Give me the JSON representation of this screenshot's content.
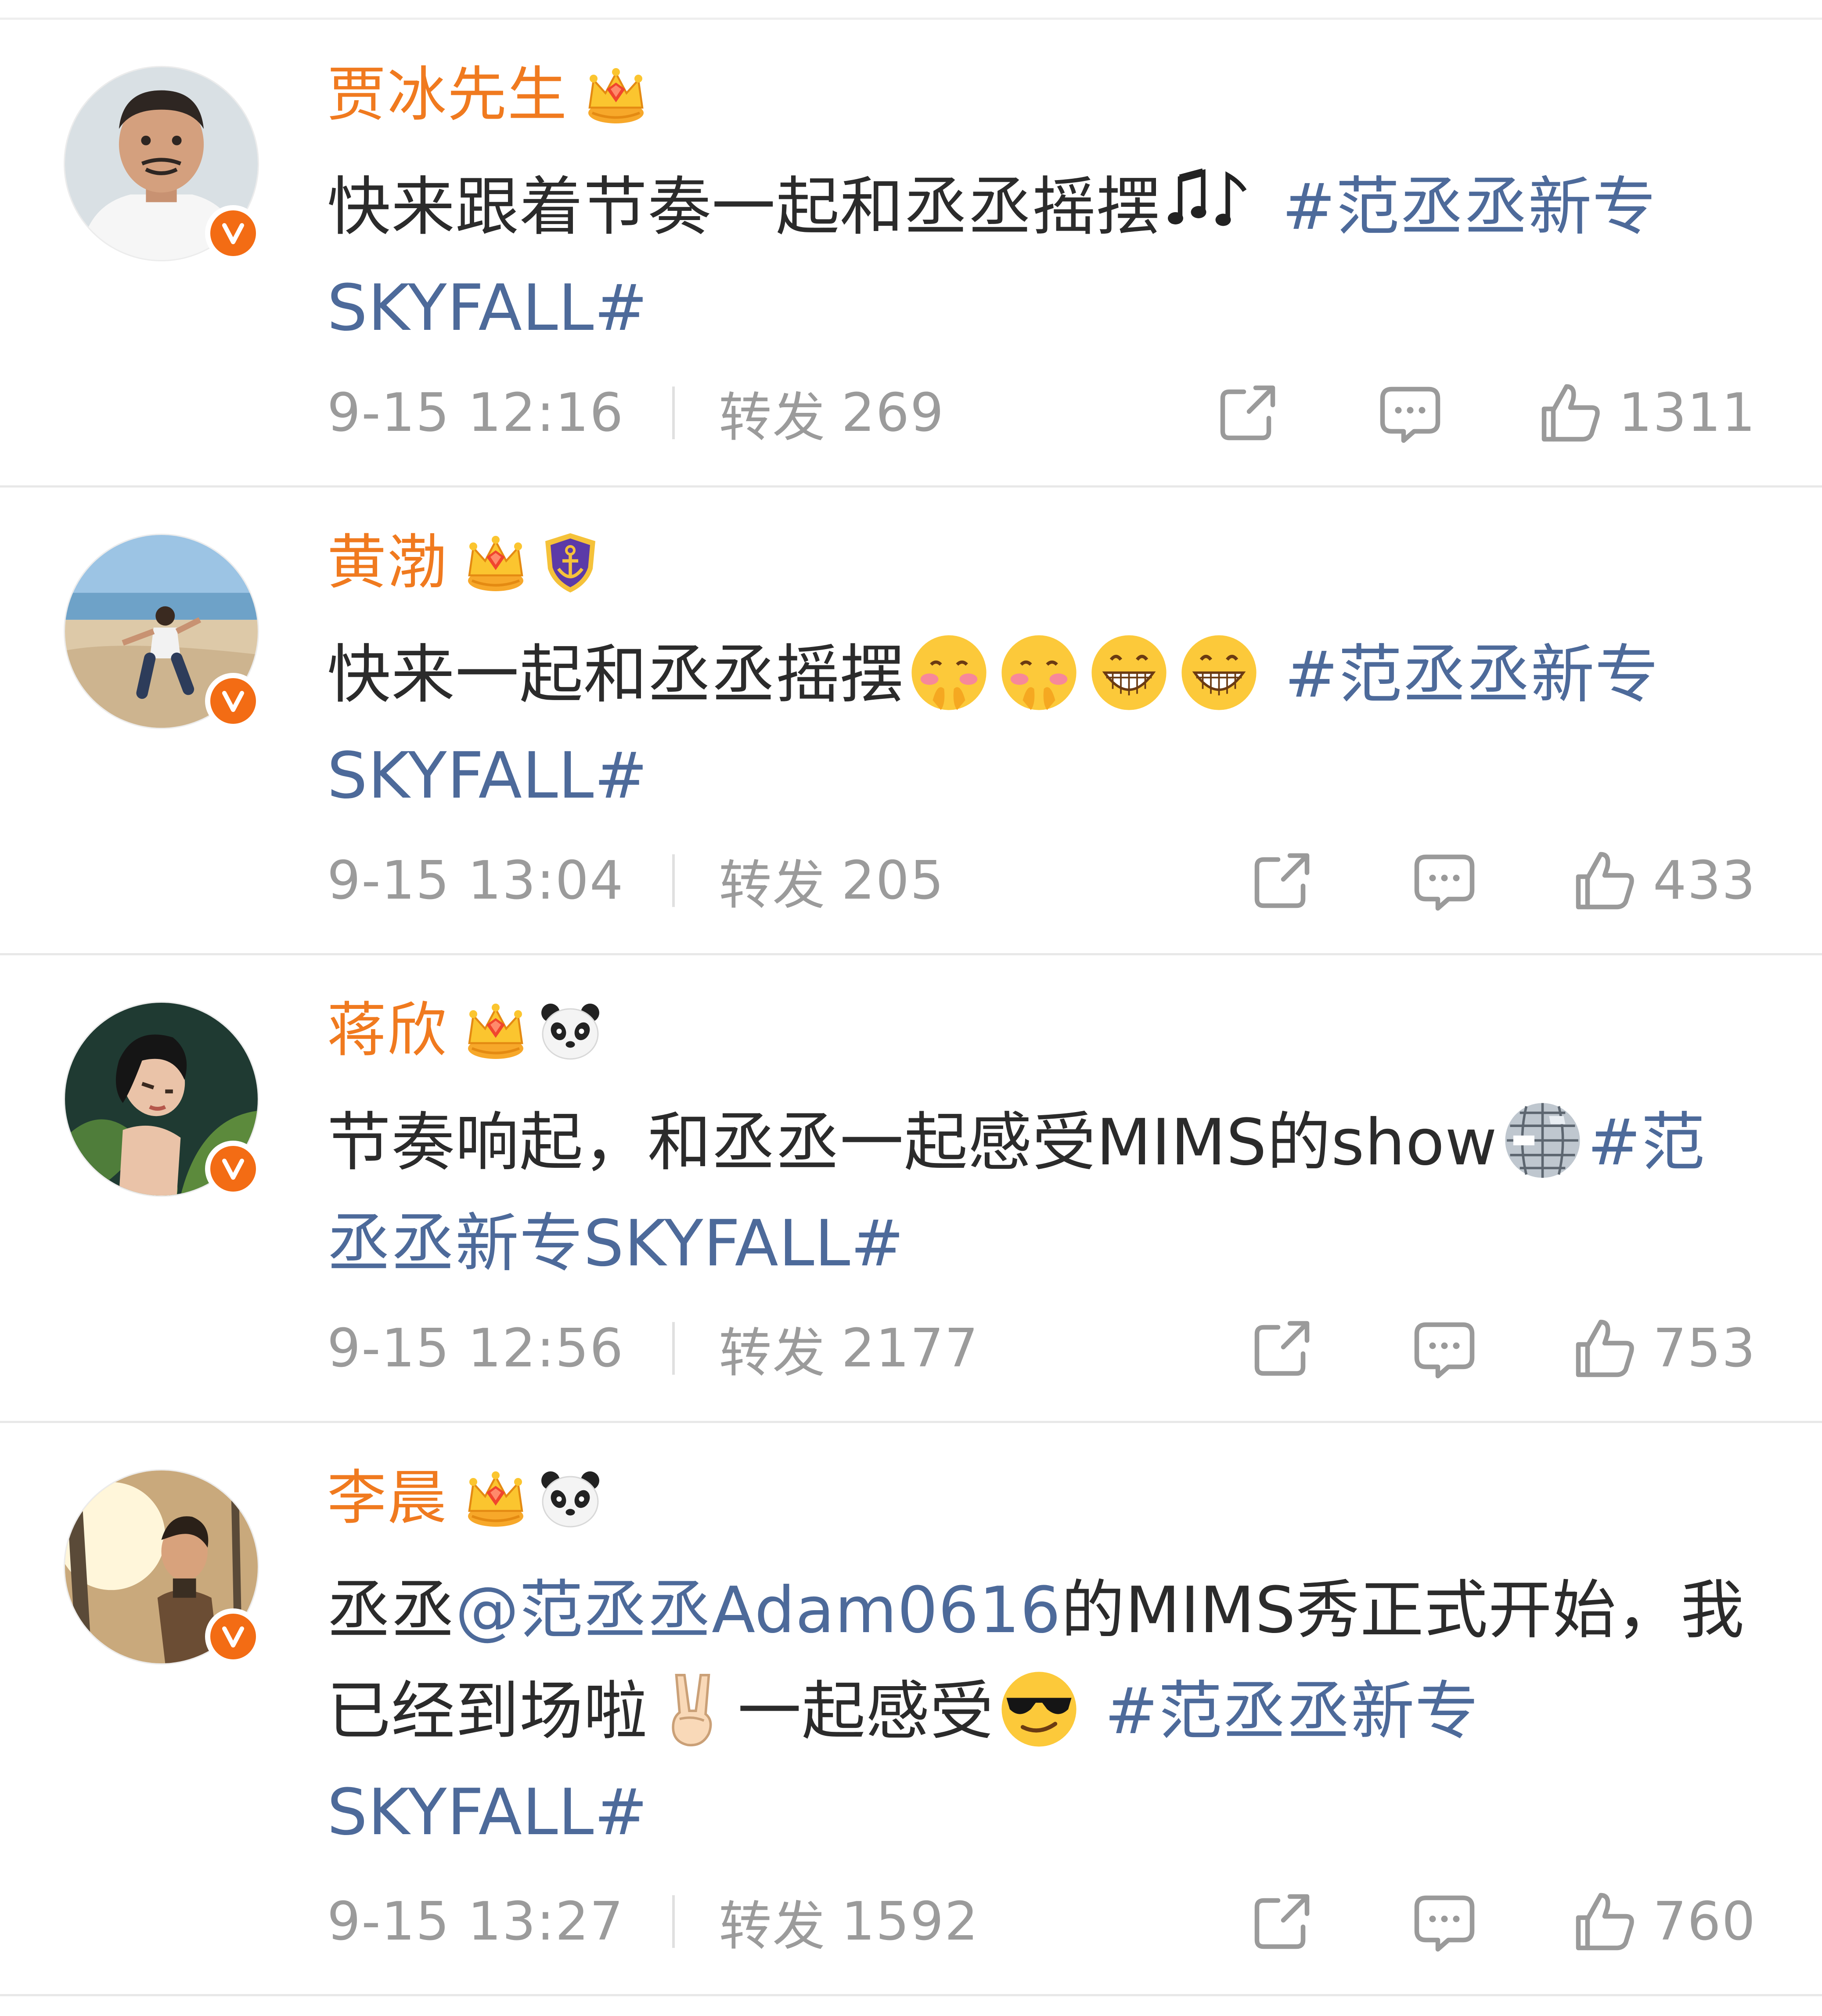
{
  "colors": {
    "username": "#f07a1f",
    "topic": "#4d6a9a",
    "body_text": "#2b2b2b",
    "meta_text": "#9b9b9b",
    "verified_badge": "#f36c14",
    "divider": "#e8e8e8"
  },
  "posts": [
    {
      "username": "贾冰先生",
      "badges": [
        "crown-icon"
      ],
      "avatar": "portrait-man-white-shirt",
      "content": {
        "text": "快来跟着节奏一起和丞丞摇摆",
        "emojis": [
          "music-notes-icon"
        ],
        "topic": "#范丞丞新专SKYFALL#"
      },
      "time": "9-15 12:16",
      "repost_label": "转发",
      "repost_count": "269",
      "like_count": "1311"
    },
    {
      "username": "黄渤",
      "badges": [
        "crown-icon",
        "anchor-shield-icon"
      ],
      "avatar": "man-on-beach",
      "content": {
        "text": "快来一起和丞丞摇摆",
        "emojis": [
          "shy-face-icon",
          "shy-face-icon",
          "grin-face-icon",
          "grin-face-icon"
        ],
        "topic": "#范丞丞新专SKYFALL#"
      },
      "time": "9-15 13:04",
      "repost_label": "转发",
      "repost_count": "205",
      "like_count": "433"
    },
    {
      "username": "蒋欣",
      "badges": [
        "crown-icon",
        "panda-icon"
      ],
      "avatar": "woman-with-plants",
      "content": {
        "text": "节奏响起，和丞丞一起感受MIMS的show",
        "emojis": [
          "disco-ball-icon"
        ],
        "topic": "#范丞丞新专SKYFALL#"
      },
      "time": "9-15 12:56",
      "repost_label": "转发",
      "repost_count": "2177",
      "like_count": "753"
    },
    {
      "username": "李晨",
      "badges": [
        "crown-icon",
        "panda-icon"
      ],
      "avatar": "man-in-sunlight",
      "content": {
        "text_before": "丞丞",
        "mention": "@范丞丞Adam0616",
        "text_middle": "的MIMS秀正式开始，我已经到场啦",
        "text_after": "一起感受",
        "emojis": [
          "victory-hand-icon",
          "sunglasses-face-icon"
        ],
        "topic": "#范丞丞新专SKYFALL#"
      },
      "time": "9-15 13:27",
      "repost_label": "转发",
      "repost_count": "1592",
      "like_count": "760"
    }
  ]
}
